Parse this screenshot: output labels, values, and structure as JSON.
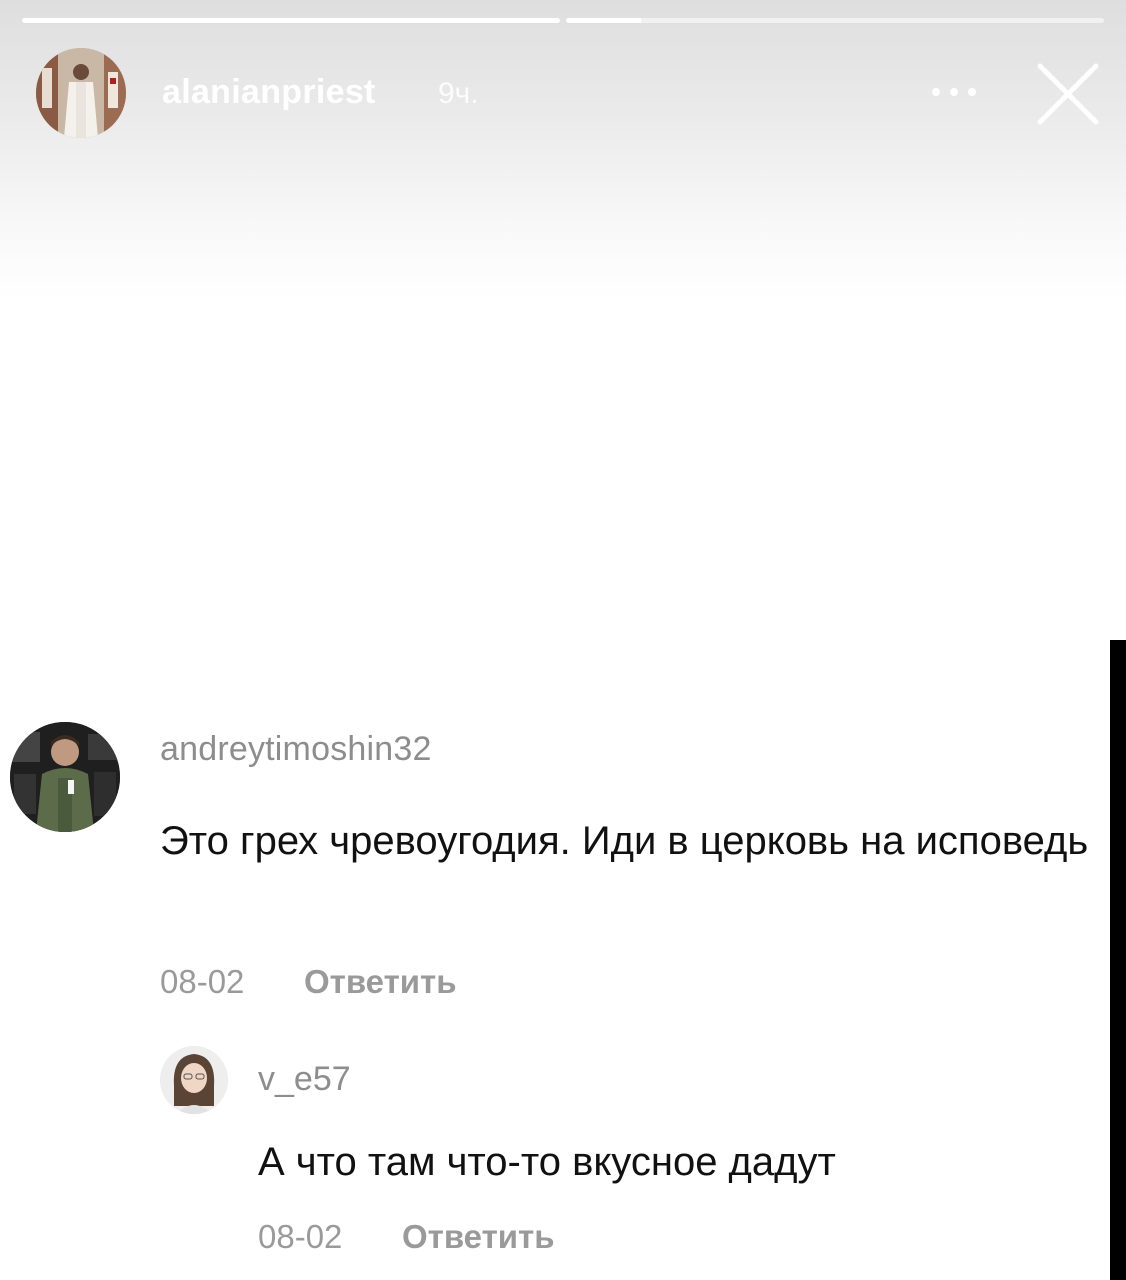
{
  "story": {
    "progress": [
      1.0,
      0.14
    ],
    "author": {
      "username": "alanianpriest",
      "time": "9ч.",
      "avatar_icon": "priest-photo-avatar"
    },
    "more_icon": "ellipsis-icon",
    "close_icon": "close-icon"
  },
  "comment": {
    "username": "andreytimoshin32",
    "text": "Это грех чревоугодия. Иди в церковь на исповедь",
    "date": "08-02",
    "reply_label": "Ответить",
    "avatar_icon": "man-photo-avatar"
  },
  "reply": {
    "username": "v_e57",
    "text": "А что там что-то вкусное дадут",
    "date": "08-02",
    "reply_label": "Ответить",
    "avatar_icon": "woman-photo-avatar"
  }
}
